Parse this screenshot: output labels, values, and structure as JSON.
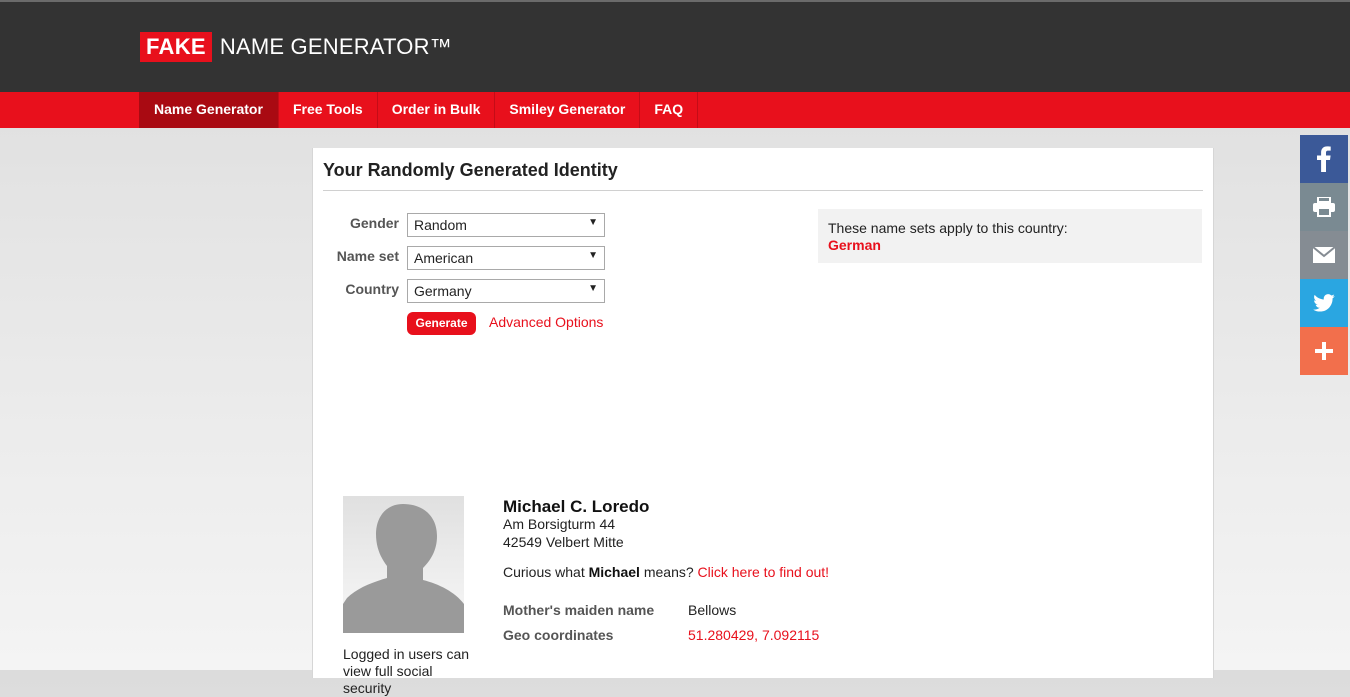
{
  "logo": {
    "fake": "FAKE",
    "rest": "NAME GENERATOR™"
  },
  "nav": {
    "items": [
      "Name Generator",
      "Free Tools",
      "Order in Bulk",
      "Smiley Generator",
      "FAQ"
    ],
    "active_index": 0
  },
  "panel": {
    "title": "Your Randomly Generated Identity",
    "form": {
      "gender_label": "Gender",
      "gender_value": "Random",
      "nameset_label": "Name set",
      "nameset_value": "American",
      "country_label": "Country",
      "country_value": "Germany",
      "generate_label": "Generate",
      "advanced_label": "Advanced Options"
    },
    "country_note": {
      "text": "These name sets apply to this country:",
      "value": "German"
    }
  },
  "identity": {
    "name": "Michael C. Loredo",
    "address_line1": "Am Borsigturm 44",
    "address_line2": "42549 Velbert Mitte",
    "curious_prefix": "Curious what ",
    "curious_name": "Michael",
    "curious_suffix": " means? ",
    "curious_link": "Click here to find out!",
    "maiden_label": "Mother's maiden name",
    "maiden_value": "Bellows",
    "geo_label": "Geo coordinates",
    "geo_value": "51.280429, 7.092115",
    "login_note": "Logged in users can view full social security"
  },
  "share": {
    "buttons": [
      {
        "icon": "facebook-icon",
        "color": "#3b5998"
      },
      {
        "icon": "print-icon",
        "color": "#7a8a92"
      },
      {
        "icon": "email-icon",
        "color": "#858c93"
      },
      {
        "icon": "twitter-icon",
        "color": "#2aa6e1"
      },
      {
        "icon": "more-plus-icon",
        "color": "#f26f4c"
      }
    ]
  },
  "colors": {
    "brand_red": "#e8101c",
    "header_dark": "#333333",
    "active_nav": "#a90a12"
  }
}
